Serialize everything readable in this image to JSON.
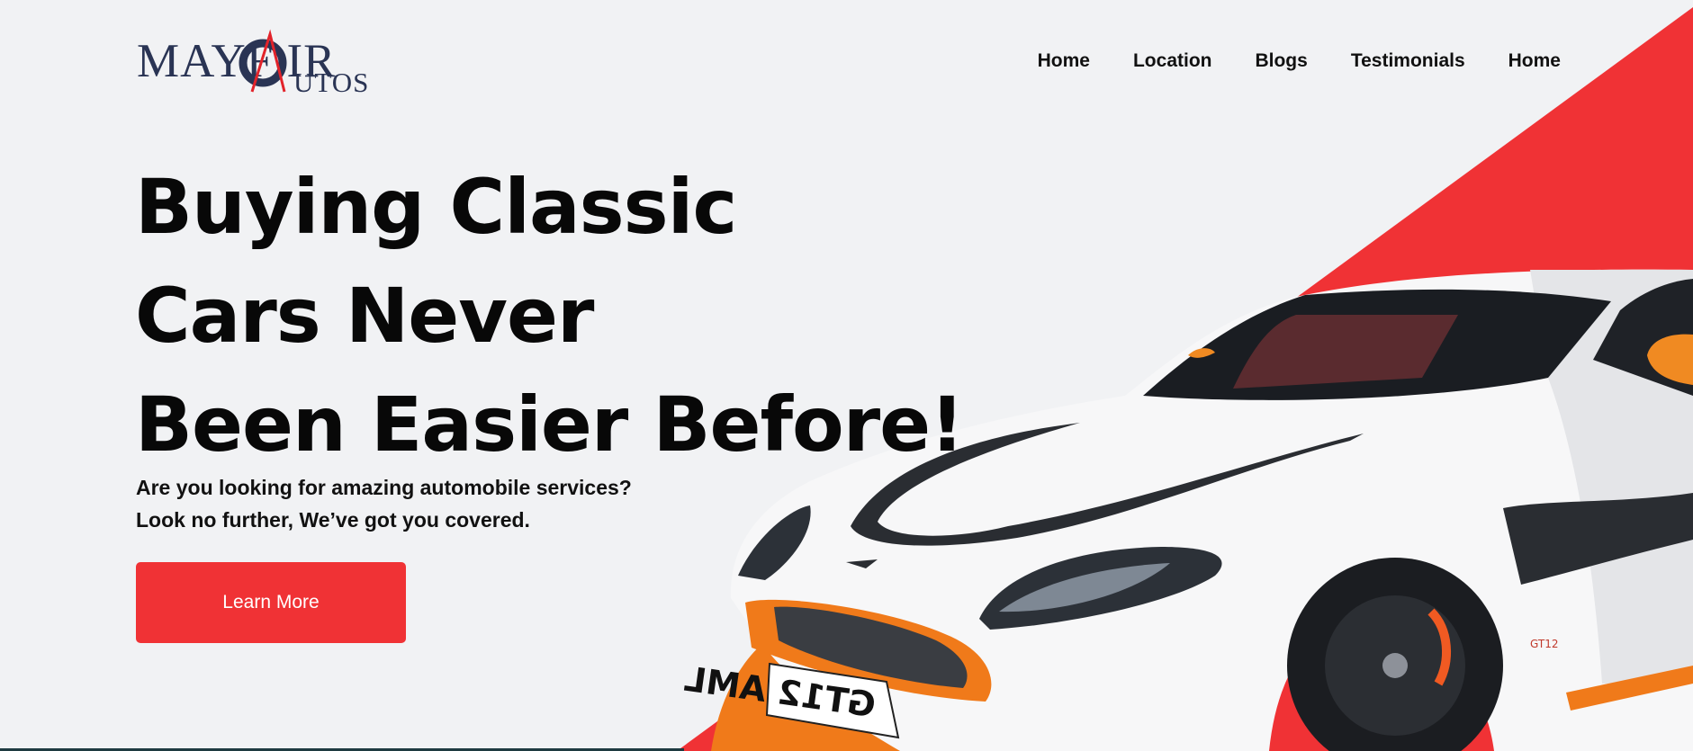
{
  "header": {
    "logo": {
      "word1": "MAYF IR",
      "word2": "UTOS",
      "alt": "Mayfair Autos"
    },
    "nav": [
      "Home",
      "Location",
      "Blogs",
      "Testimonials",
      "Home"
    ]
  },
  "hero": {
    "title_lines": [
      "Buying Classic",
      "Cars Never",
      "Been Easier Before!"
    ],
    "subtitle_lines": [
      "Are you looking for amazing automobile services?",
      "Look no further, We’ve got you covered."
    ],
    "cta_label": "Learn More"
  },
  "car": {
    "plate": "GT12 AML",
    "badge": "GT12"
  },
  "colors": {
    "accent": "#f03235",
    "background": "#f1f2f4",
    "text": "#080808",
    "logo_navy": "#2a3454"
  }
}
